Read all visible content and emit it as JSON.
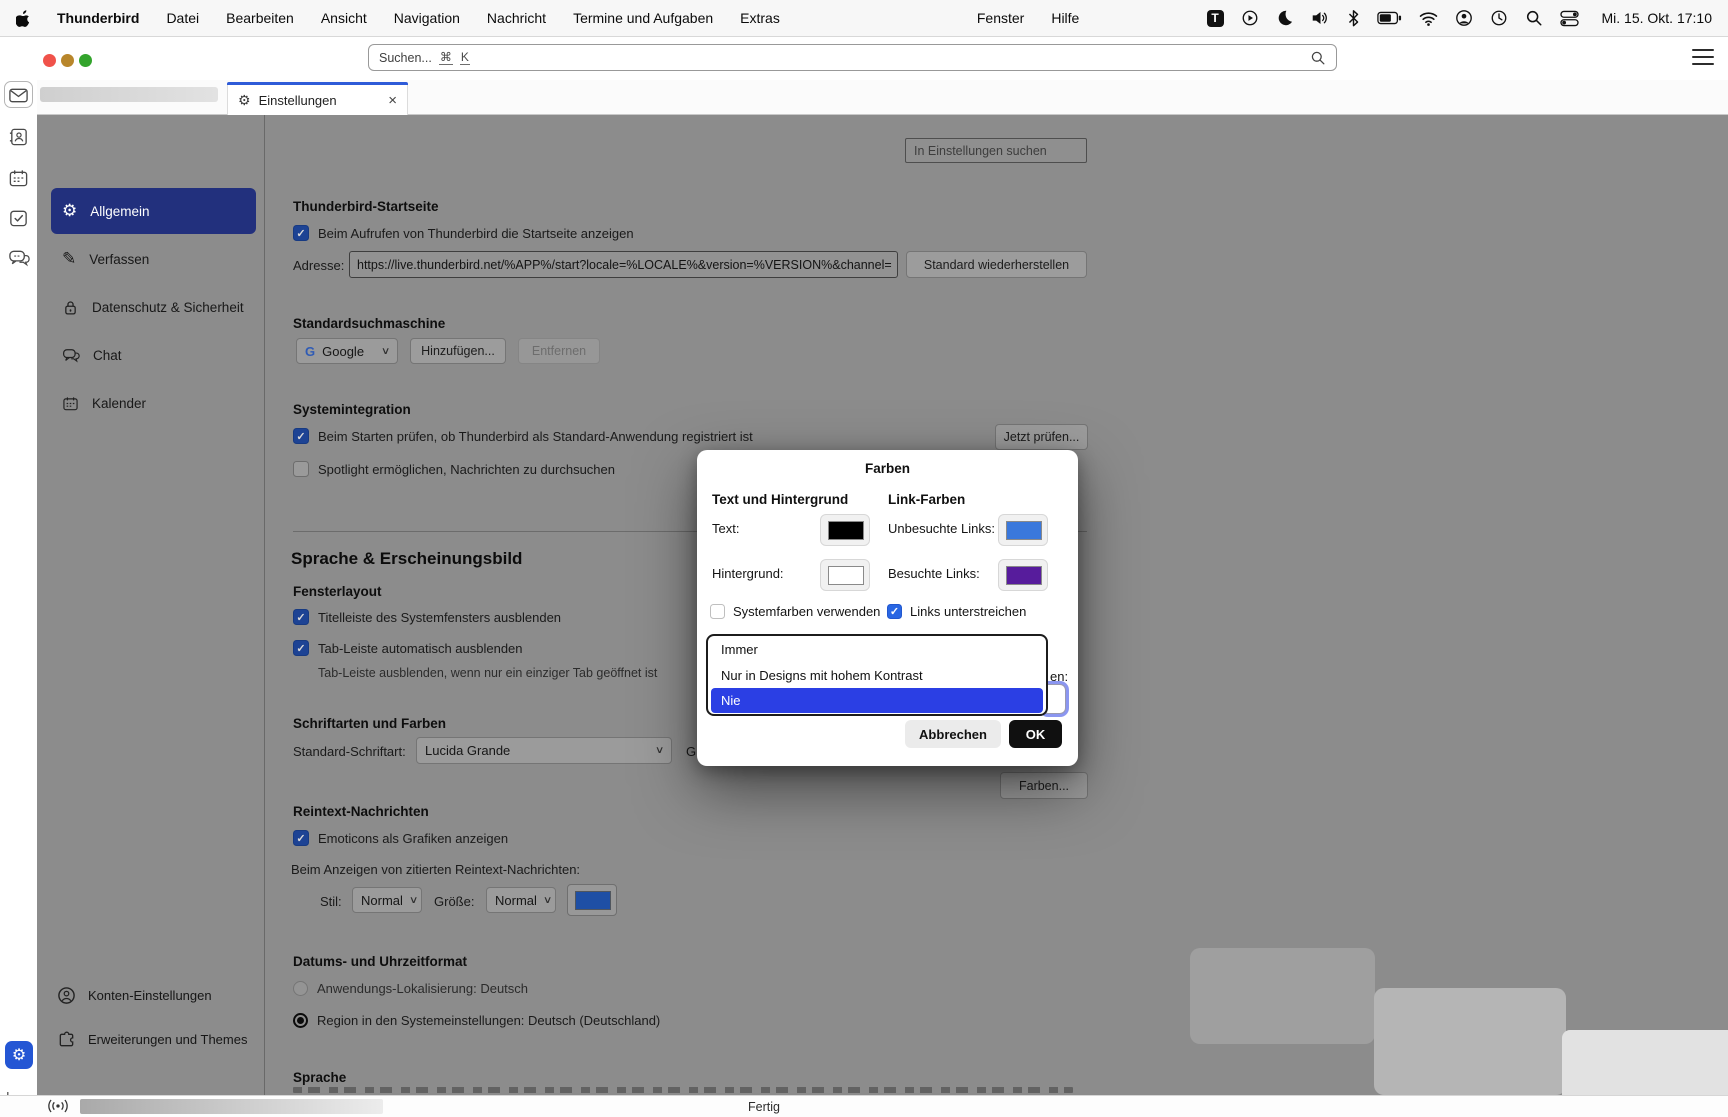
{
  "glyphs": {
    "check": "✓",
    "chevron": "∨",
    "close": "×",
    "gear": "⚙",
    "pencil": "✎",
    "collapse": "|←"
  },
  "menu_bar": {
    "app_menus": [
      "Thunderbird",
      "Datei",
      "Bearbeiten",
      "Ansicht",
      "Navigation",
      "Nachricht",
      "Termine und Aufgaben",
      "Extras"
    ],
    "window_menus": [
      "Fenster",
      "Hilfe"
    ],
    "status_icons": [
      "thunderbird-badge",
      "play-circle",
      "moon",
      "volume",
      "bluetooth",
      "battery",
      "wifi",
      "user-circle",
      "history",
      "search",
      "control-center"
    ],
    "badge_letter": "T",
    "clock": "Mi. 15. Okt. 17:10"
  },
  "toolbar": {
    "search_placeholder": "Suchen...",
    "search_shortcut_mod": "⌘",
    "search_shortcut_key": "K"
  },
  "tab_bar": {
    "settings_tab_label": "Einstellungen"
  },
  "spaces": {
    "items": [
      "mail-space",
      "address-book-space",
      "calendar-space",
      "tasks-space",
      "chat-space",
      "settings-space",
      "collapse-spaces"
    ]
  },
  "sidebar": {
    "items": [
      {
        "label": "Allgemein",
        "icon": "gear-icon",
        "selected": true
      },
      {
        "label": "Verfassen",
        "icon": "pencil-icon",
        "selected": false
      },
      {
        "label": "Datenschutz & Sicherheit",
        "icon": "lock-icon",
        "selected": false
      },
      {
        "label": "Chat",
        "icon": "chat-icon",
        "selected": false
      },
      {
        "label": "Kalender",
        "icon": "calendar-icon",
        "selected": false
      }
    ],
    "footer": [
      {
        "label": "Konten-Einstellungen",
        "icon": "account-icon"
      },
      {
        "label": "Erweiterungen und Themes",
        "icon": "puzzle-icon"
      }
    ]
  },
  "content": {
    "search_placeholder": "In Einstellungen suchen",
    "startseite": {
      "heading": "Thunderbird-Startseite",
      "show_start_page": {
        "label": "Beim Aufrufen von Thunderbird die Startseite anzeigen",
        "checked": true
      },
      "address_label": "Adresse:",
      "address_value": "https://live.thunderbird.net/%APP%/start?locale=%LOCALE%&version=%VERSION%&channel=",
      "restore_button": "Standard wiederherstellen"
    },
    "suchmaschine": {
      "heading": "Standardsuchmaschine",
      "engine_letter": "G",
      "engine": "Google",
      "add_button": "Hinzufügen...",
      "remove_button": "Entfernen"
    },
    "systemintegration": {
      "heading": "Systemintegration",
      "check_default": {
        "label": "Beim Starten prüfen, ob Thunderbird als Standard-Anwendung registriert ist",
        "checked": true
      },
      "check_button": "Jetzt prüfen...",
      "spotlight": {
        "label": "Spotlight ermöglichen, Nachrichten zu durchsuchen",
        "checked": false
      }
    },
    "erscheinungsbild": {
      "heading": "Sprache & Erscheinungsbild",
      "fensterlayout_heading": "Fensterlayout",
      "hide_titlebar": {
        "label": "Titelleiste des Systemfensters ausblenden",
        "checked": true
      },
      "autohide_tabbar": {
        "label": "Tab-Leiste automatisch ausblenden",
        "checked": true
      },
      "autohide_note": "Tab-Leiste ausblenden, wenn nur ein einziger Tab geöffnet ist"
    },
    "schriftarten": {
      "heading": "Schriftarten und Farben",
      "font_label": "Standard-Schriftart:",
      "font_value": "Lucida Grande",
      "size_label_fragment": "Gr",
      "colors_button": "Farben..."
    },
    "reintext": {
      "heading": "Reintext-Nachrichten",
      "emoticons": {
        "label": "Emoticons als Grafiken anzeigen",
        "checked": true
      },
      "quoted_label": "Beim Anzeigen von zitierten Reintext-Nachrichten:",
      "stil_label": "Stil:",
      "stil_value": "Normal",
      "groesse_label": "Größe:",
      "groesse_value": "Normal",
      "quote_color": "#1e4fa5"
    },
    "datum": {
      "heading": "Datums- und Uhrzeitformat",
      "radio_app": {
        "label": "Anwendungs-Lokalisierung: Deutsch",
        "selected": false
      },
      "radio_region": {
        "label": "Region in den Systemeinstellungen: Deutsch (Deutschland)",
        "selected": true
      }
    },
    "sprache_heading": "Sprache"
  },
  "dialog": {
    "title": "Farben",
    "col_text_bg": "Text und Hintergrund",
    "col_links": "Link-Farben",
    "text_label": "Text:",
    "bg_label": "Hintergrund:",
    "unvisited_label": "Unbesuchte Links:",
    "visited_label": "Besuchte Links:",
    "system_colors": {
      "label": "Systemfarben verwenden",
      "checked": false
    },
    "underline_links": {
      "label": "Links unterstreichen",
      "checked": true
    },
    "override_label_visible_fragment": "en:",
    "options": [
      "Immer",
      "Nur in Designs mit hohem Kontrast",
      "Nie"
    ],
    "selected_option": "Nie",
    "cancel_button": "Abbrechen",
    "ok_button": "OK",
    "colors": {
      "text": "#000000",
      "background": "#ffffff",
      "unvisited": "#3a78dc",
      "visited": "#571c9c",
      "highlight": "#2b3fe4",
      "accent": "#2966e3"
    }
  },
  "status_bar": {
    "status": "Fertig"
  }
}
